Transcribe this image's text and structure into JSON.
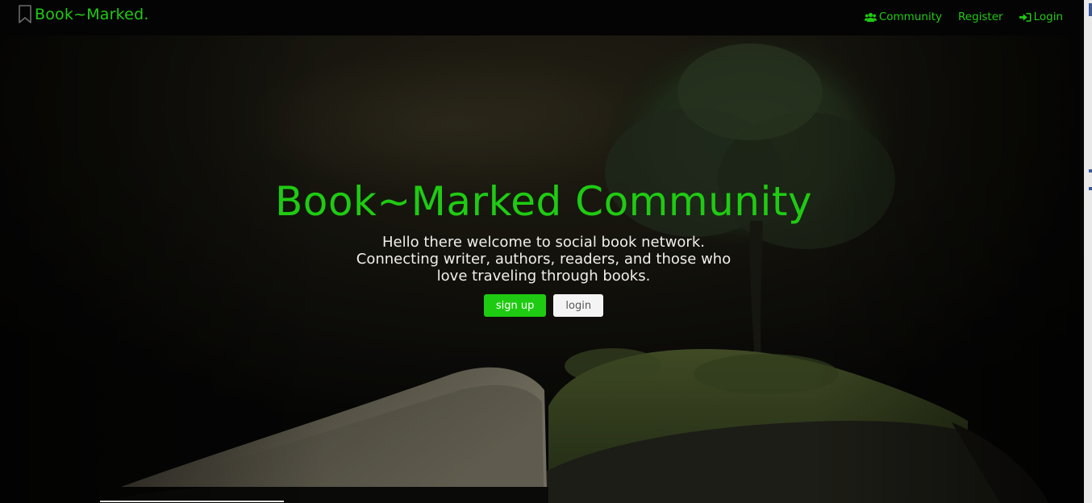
{
  "brand": {
    "name": "Book~Marked.",
    "icon": "bookmark-icon"
  },
  "nav": {
    "items": [
      {
        "label": "Community",
        "icon": "users-icon"
      },
      {
        "label": "Register",
        "icon": ""
      },
      {
        "label": "Login",
        "icon": "sign-in-icon"
      }
    ]
  },
  "hero": {
    "title": "Book~Marked Community",
    "description": "Hello there welcome to social book network. Connecting writer, authors, readers, and those who love traveling through books.",
    "signup_label": "sign up",
    "login_label": "login",
    "background": "open-book-with-tree-image"
  },
  "colors": {
    "accent": "#1fcb12",
    "navbar": "#040404",
    "text": "#f0efe9"
  }
}
